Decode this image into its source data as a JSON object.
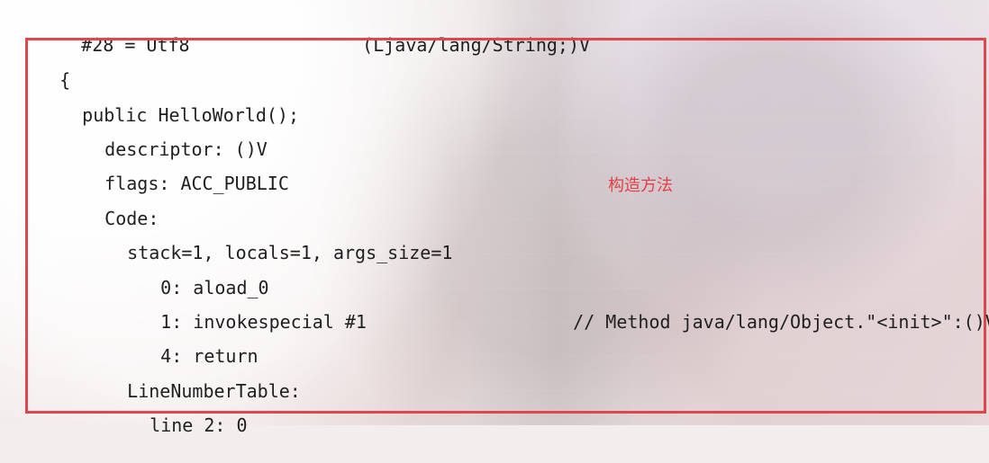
{
  "header_line": {
    "left": "#28 = Utf8",
    "right": "(Ljava/lang/String;)V"
  },
  "annotation": "构造方法",
  "code_block": {
    "lines": [
      "{",
      "public HelloWorld();",
      "descriptor: ()V",
      "flags: ACC_PUBLIC",
      "Code:",
      "stack=1, locals=1, args_size=1",
      "0: aload_0",
      "1: invokespecial #1",
      "// Method java/lang/Object.\"<init>\":()V",
      "4: return",
      "LineNumberTable:",
      "line 2: 0"
    ]
  }
}
